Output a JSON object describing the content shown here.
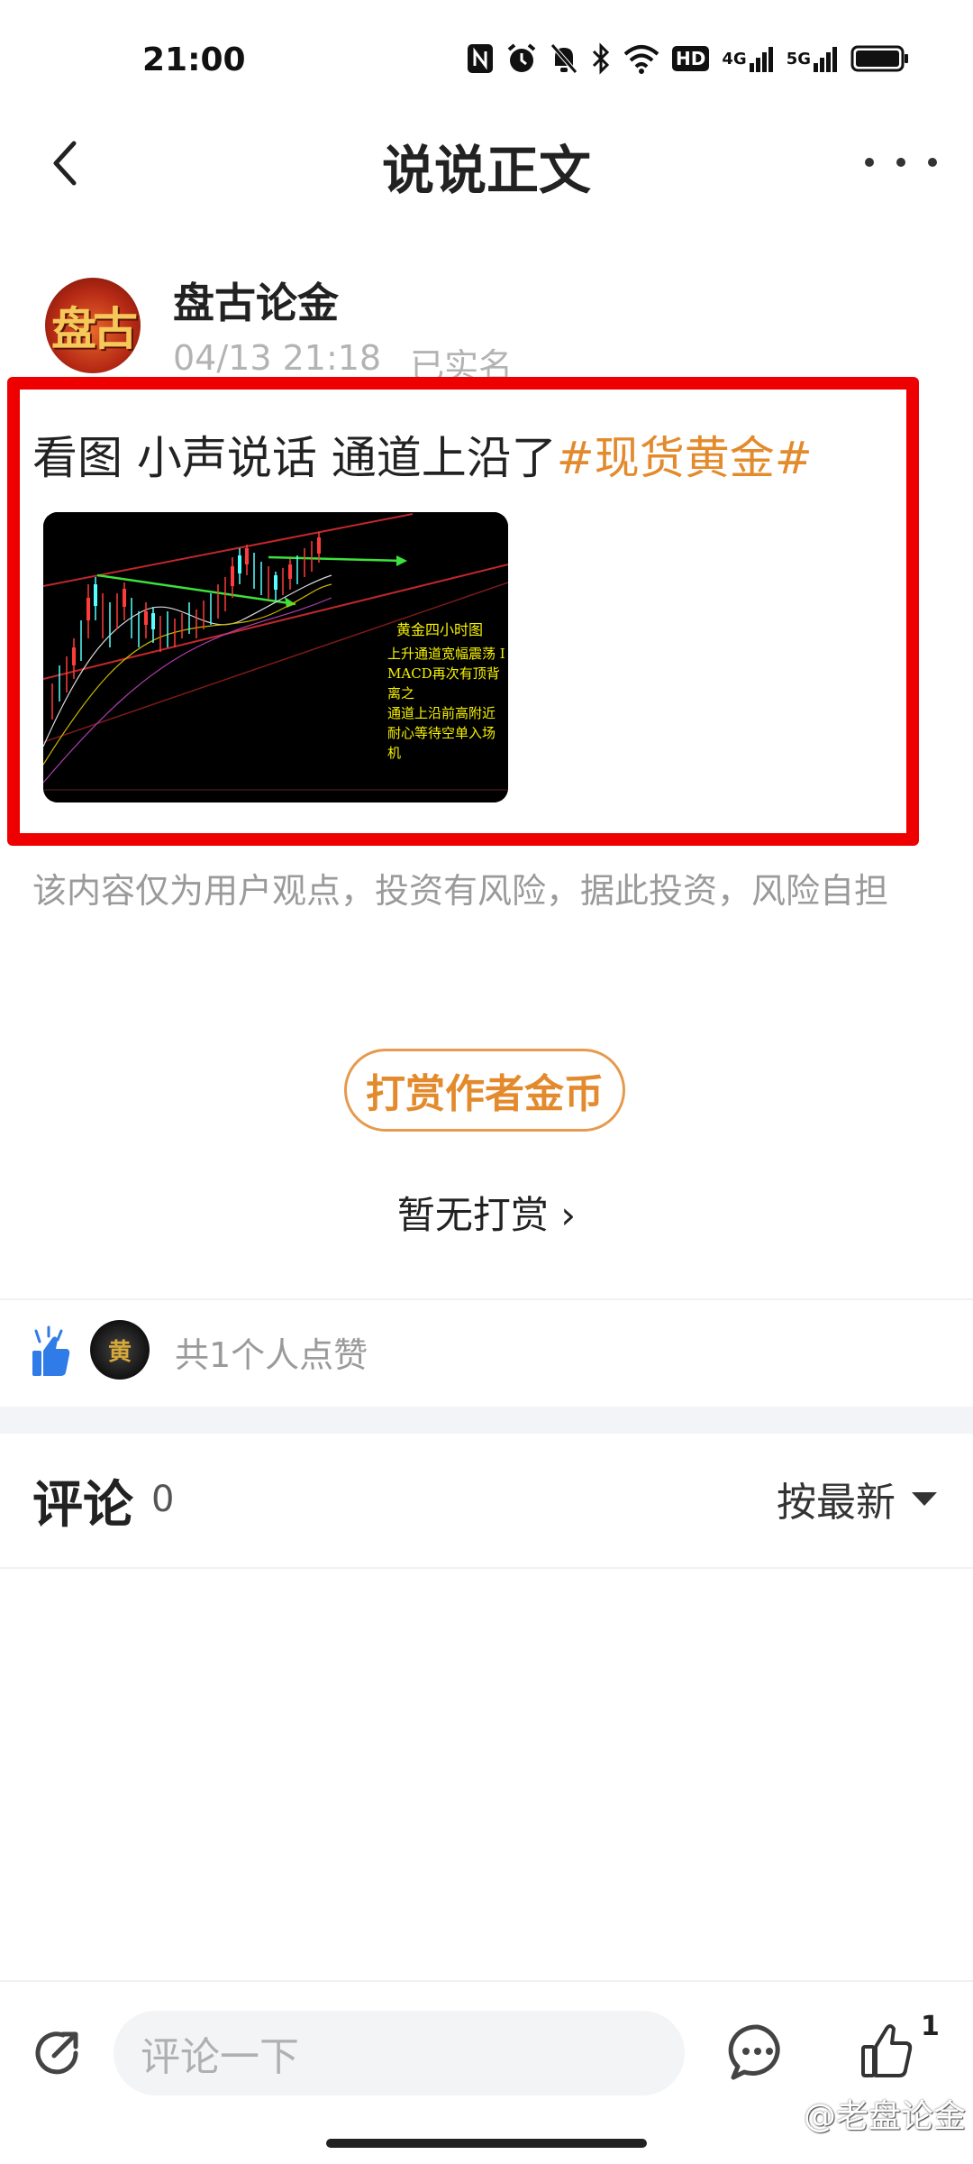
{
  "status_bar": {
    "time": "21:00",
    "icons": [
      "nfc-icon",
      "alarm-icon",
      "mute-icon",
      "bluetooth-icon",
      "wifi-icon",
      "hd-icon",
      "signal-4g-icon",
      "signal-5g-icon",
      "battery-icon"
    ],
    "hd_label": "HD",
    "net1_label": "4G",
    "net2_label": "5G"
  },
  "header": {
    "title": "说说正文"
  },
  "post": {
    "author_name": "盘古论金",
    "avatar_text": "盘古",
    "date": "04/13 21:18",
    "verified": "已实名",
    "text": "看图 小声说话 通道上沿了",
    "topic": "#现货黄金#",
    "image_note": {
      "title": "黄金四小时图",
      "lines": [
        "上升通道宽幅震荡 I",
        "MACD再次有顶背离之",
        "通道上沿前高附近",
        "耐心等待空单入场机"
      ]
    },
    "disclaimer": "该内容仅为用户观点，投资有风险，据此投资，风险自担"
  },
  "reward": {
    "button_label": "打赏作者金币",
    "status": "暂无打赏 ›"
  },
  "likes": {
    "liker_avatar_text": "黄",
    "text": "共1个人点赞",
    "accent_color": "#2f7be8"
  },
  "comments": {
    "title": "评论",
    "count": "0",
    "sort_label": "按最新"
  },
  "bottom_bar": {
    "placeholder": "评论一下",
    "like_count": "1",
    "watermark": "@老盘论金"
  },
  "colors": {
    "highlight": "#ef0000",
    "topic": "#e38a2c",
    "muted": "#9a9a9a"
  }
}
